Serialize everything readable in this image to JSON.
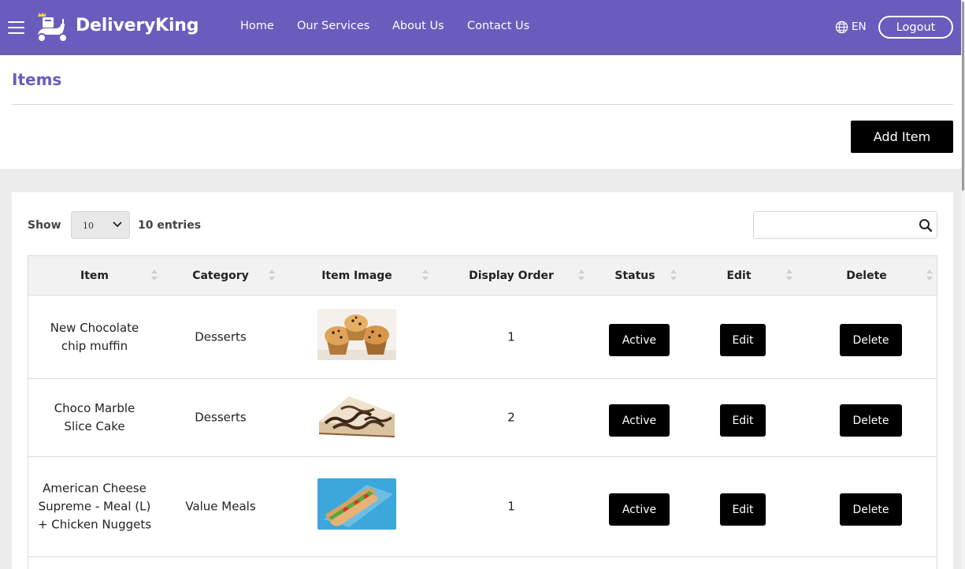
{
  "header": {
    "brand": "DeliveryKing",
    "nav": [
      {
        "label": "Home"
      },
      {
        "label": "Our Services"
      },
      {
        "label": "About Us"
      },
      {
        "label": "Contact Us"
      }
    ],
    "language": "EN",
    "logout_label": "Logout",
    "accent_color": "#6a5cbd"
  },
  "page": {
    "title": "Items",
    "add_button_label": "Add Item"
  },
  "table_controls": {
    "show_label": "Show",
    "page_size": "10",
    "entries_label": "10 entries",
    "search_value": ""
  },
  "table": {
    "columns": [
      "Item",
      "Category",
      "Item Image",
      "Display Order",
      "Status",
      "Edit",
      "Delete"
    ],
    "rows": [
      {
        "item": "New Chocolate chip muffin",
        "category": "Desserts",
        "image": "muffins-photo",
        "display_order": "1",
        "status": "Active",
        "edit": "Edit",
        "delete": "Delete"
      },
      {
        "item": "Choco Marble Slice Cake",
        "category": "Desserts",
        "image": "marble-cake-photo",
        "display_order": "2",
        "status": "Active",
        "edit": "Edit",
        "delete": "Delete"
      },
      {
        "item": "American Cheese Supreme - Meal (L) + Chicken Nuggets",
        "category": "Value Meals",
        "image": "sandwich-photo",
        "display_order": "1",
        "status": "Active",
        "edit": "Edit",
        "delete": "Delete"
      }
    ]
  }
}
